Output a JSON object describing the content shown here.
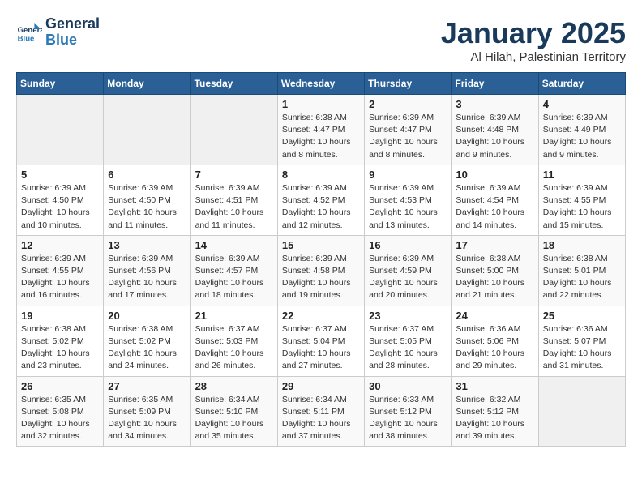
{
  "header": {
    "logo_line1": "General",
    "logo_line2": "Blue",
    "month": "January 2025",
    "location": "Al Hilah, Palestinian Territory"
  },
  "weekdays": [
    "Sunday",
    "Monday",
    "Tuesday",
    "Wednesday",
    "Thursday",
    "Friday",
    "Saturday"
  ],
  "weeks": [
    [
      {
        "day": "",
        "info": ""
      },
      {
        "day": "",
        "info": ""
      },
      {
        "day": "",
        "info": ""
      },
      {
        "day": "1",
        "info": "Sunrise: 6:38 AM\nSunset: 4:47 PM\nDaylight: 10 hours\nand 8 minutes."
      },
      {
        "day": "2",
        "info": "Sunrise: 6:39 AM\nSunset: 4:47 PM\nDaylight: 10 hours\nand 8 minutes."
      },
      {
        "day": "3",
        "info": "Sunrise: 6:39 AM\nSunset: 4:48 PM\nDaylight: 10 hours\nand 9 minutes."
      },
      {
        "day": "4",
        "info": "Sunrise: 6:39 AM\nSunset: 4:49 PM\nDaylight: 10 hours\nand 9 minutes."
      }
    ],
    [
      {
        "day": "5",
        "info": "Sunrise: 6:39 AM\nSunset: 4:50 PM\nDaylight: 10 hours\nand 10 minutes."
      },
      {
        "day": "6",
        "info": "Sunrise: 6:39 AM\nSunset: 4:50 PM\nDaylight: 10 hours\nand 11 minutes."
      },
      {
        "day": "7",
        "info": "Sunrise: 6:39 AM\nSunset: 4:51 PM\nDaylight: 10 hours\nand 11 minutes."
      },
      {
        "day": "8",
        "info": "Sunrise: 6:39 AM\nSunset: 4:52 PM\nDaylight: 10 hours\nand 12 minutes."
      },
      {
        "day": "9",
        "info": "Sunrise: 6:39 AM\nSunset: 4:53 PM\nDaylight: 10 hours\nand 13 minutes."
      },
      {
        "day": "10",
        "info": "Sunrise: 6:39 AM\nSunset: 4:54 PM\nDaylight: 10 hours\nand 14 minutes."
      },
      {
        "day": "11",
        "info": "Sunrise: 6:39 AM\nSunset: 4:55 PM\nDaylight: 10 hours\nand 15 minutes."
      }
    ],
    [
      {
        "day": "12",
        "info": "Sunrise: 6:39 AM\nSunset: 4:55 PM\nDaylight: 10 hours\nand 16 minutes."
      },
      {
        "day": "13",
        "info": "Sunrise: 6:39 AM\nSunset: 4:56 PM\nDaylight: 10 hours\nand 17 minutes."
      },
      {
        "day": "14",
        "info": "Sunrise: 6:39 AM\nSunset: 4:57 PM\nDaylight: 10 hours\nand 18 minutes."
      },
      {
        "day": "15",
        "info": "Sunrise: 6:39 AM\nSunset: 4:58 PM\nDaylight: 10 hours\nand 19 minutes."
      },
      {
        "day": "16",
        "info": "Sunrise: 6:39 AM\nSunset: 4:59 PM\nDaylight: 10 hours\nand 20 minutes."
      },
      {
        "day": "17",
        "info": "Sunrise: 6:38 AM\nSunset: 5:00 PM\nDaylight: 10 hours\nand 21 minutes."
      },
      {
        "day": "18",
        "info": "Sunrise: 6:38 AM\nSunset: 5:01 PM\nDaylight: 10 hours\nand 22 minutes."
      }
    ],
    [
      {
        "day": "19",
        "info": "Sunrise: 6:38 AM\nSunset: 5:02 PM\nDaylight: 10 hours\nand 23 minutes."
      },
      {
        "day": "20",
        "info": "Sunrise: 6:38 AM\nSunset: 5:02 PM\nDaylight: 10 hours\nand 24 minutes."
      },
      {
        "day": "21",
        "info": "Sunrise: 6:37 AM\nSunset: 5:03 PM\nDaylight: 10 hours\nand 26 minutes."
      },
      {
        "day": "22",
        "info": "Sunrise: 6:37 AM\nSunset: 5:04 PM\nDaylight: 10 hours\nand 27 minutes."
      },
      {
        "day": "23",
        "info": "Sunrise: 6:37 AM\nSunset: 5:05 PM\nDaylight: 10 hours\nand 28 minutes."
      },
      {
        "day": "24",
        "info": "Sunrise: 6:36 AM\nSunset: 5:06 PM\nDaylight: 10 hours\nand 29 minutes."
      },
      {
        "day": "25",
        "info": "Sunrise: 6:36 AM\nSunset: 5:07 PM\nDaylight: 10 hours\nand 31 minutes."
      }
    ],
    [
      {
        "day": "26",
        "info": "Sunrise: 6:35 AM\nSunset: 5:08 PM\nDaylight: 10 hours\nand 32 minutes."
      },
      {
        "day": "27",
        "info": "Sunrise: 6:35 AM\nSunset: 5:09 PM\nDaylight: 10 hours\nand 34 minutes."
      },
      {
        "day": "28",
        "info": "Sunrise: 6:34 AM\nSunset: 5:10 PM\nDaylight: 10 hours\nand 35 minutes."
      },
      {
        "day": "29",
        "info": "Sunrise: 6:34 AM\nSunset: 5:11 PM\nDaylight: 10 hours\nand 37 minutes."
      },
      {
        "day": "30",
        "info": "Sunrise: 6:33 AM\nSunset: 5:12 PM\nDaylight: 10 hours\nand 38 minutes."
      },
      {
        "day": "31",
        "info": "Sunrise: 6:32 AM\nSunset: 5:12 PM\nDaylight: 10 hours\nand 39 minutes."
      },
      {
        "day": "",
        "info": ""
      }
    ]
  ]
}
